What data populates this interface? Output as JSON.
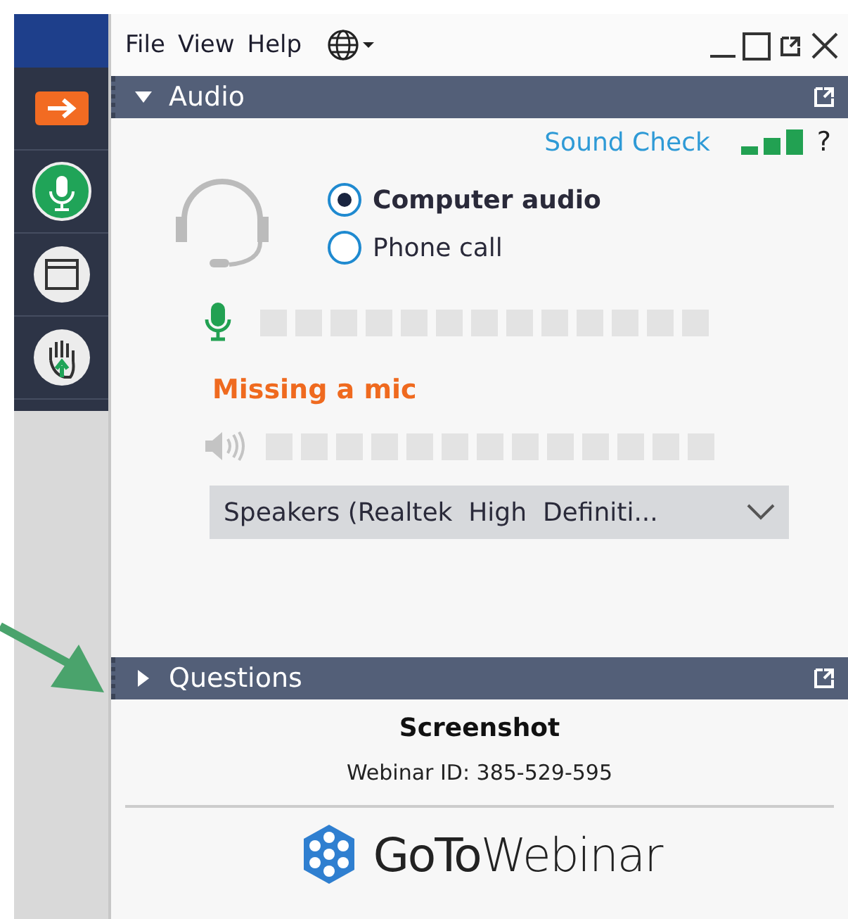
{
  "menu": [
    {
      "label": "File"
    },
    {
      "label": "View"
    },
    {
      "label": "Help"
    }
  ],
  "window_controls": [
    {
      "kind": "minimize"
    },
    {
      "kind": "maximize"
    },
    {
      "kind": "popout"
    },
    {
      "kind": "close"
    }
  ],
  "sidebar": [
    {
      "kind": "exit"
    },
    {
      "kind": "mic"
    },
    {
      "kind": "screen"
    },
    {
      "kind": "hand"
    }
  ],
  "audio": {
    "title": "Audio",
    "expanded": true,
    "sound_check": "Sound Check",
    "help": "?",
    "options": [
      {
        "label": "Computer audio",
        "selected": true
      },
      {
        "label": "Phone call",
        "selected": false
      }
    ],
    "mic_meter": {
      "level": 0
    },
    "mic_status": "Missing a mic",
    "speaker_meter": {
      "level": 0
    },
    "speaker_device": "Speakers (Realtek  High  Definiti..."
  },
  "questions": {
    "title": "Questions",
    "expanded": false
  },
  "footer": {
    "title": "Screenshot",
    "webinar_id": "Webinar ID: 385-529-595",
    "logo": "**GoTo**Webinar"
  }
}
